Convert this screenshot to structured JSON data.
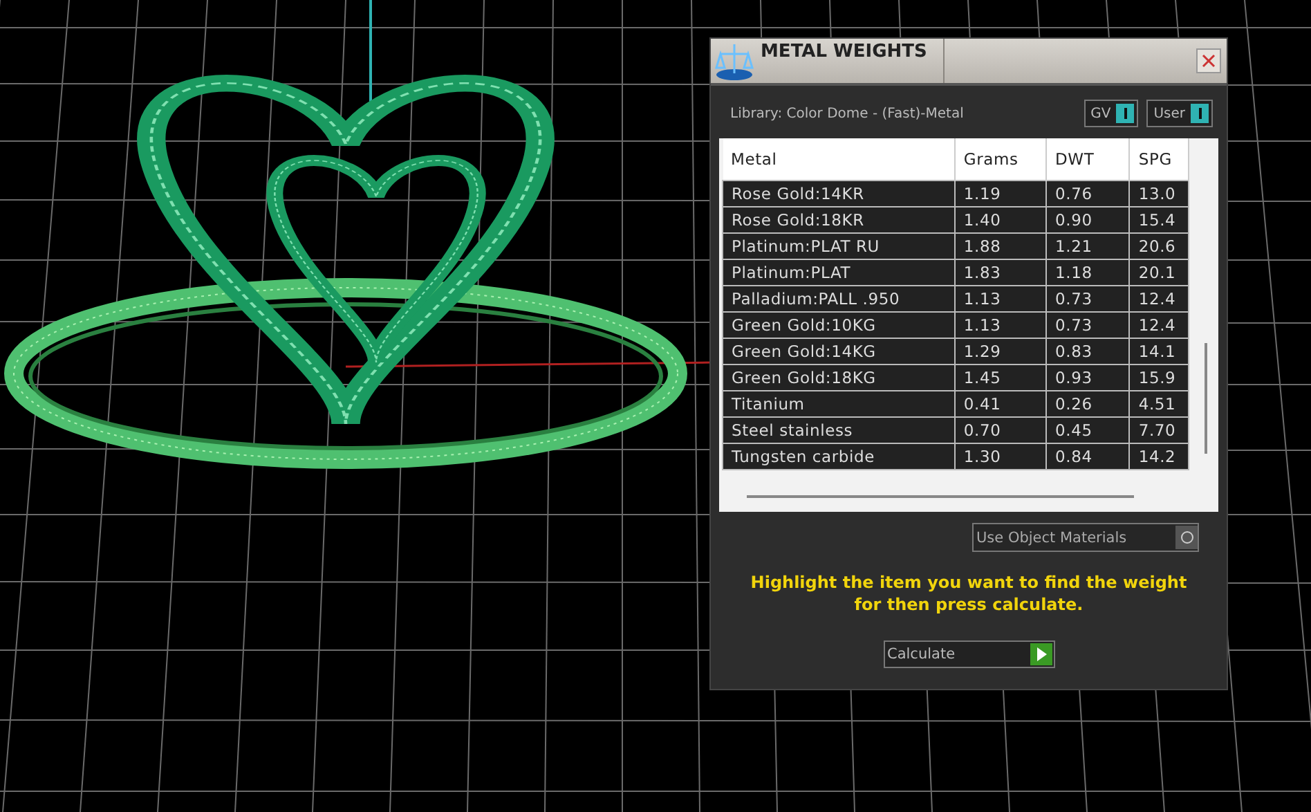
{
  "dialog": {
    "title": "METAL WEIGHTS",
    "library": "Library: Color Dome - (Fast)-Metal",
    "toggles": [
      {
        "label": "GV",
        "on": true
      },
      {
        "label": "User",
        "on": true
      }
    ],
    "table": {
      "columns": [
        "Metal",
        "Grams",
        "DWT",
        "SPG"
      ],
      "rows": [
        [
          "Rose Gold:14KR",
          "1.19",
          "0.76",
          "13.0"
        ],
        [
          "Rose Gold:18KR",
          "1.40",
          "0.90",
          "15.4"
        ],
        [
          "Platinum:PLAT RU",
          "1.88",
          "1.21",
          "20.6"
        ],
        [
          "Platinum:PLAT",
          "1.83",
          "1.18",
          "20.1"
        ],
        [
          "Palladium:PALL .950",
          "1.13",
          "0.73",
          "12.4"
        ],
        [
          "Green Gold:10KG",
          "1.13",
          "0.73",
          "12.4"
        ],
        [
          "Green Gold:14KG",
          "1.29",
          "0.83",
          "14.1"
        ],
        [
          "Green Gold:18KG",
          "1.45",
          "0.93",
          "15.9"
        ],
        [
          "Titanium",
          "0.41",
          "0.26",
          "4.51"
        ],
        [
          "Steel stainless",
          "0.70",
          "0.45",
          "7.70"
        ],
        [
          "Tungsten carbide",
          "1.30",
          "0.84",
          "14.2"
        ]
      ]
    },
    "use_object_materials": {
      "label": "Use Object Materials",
      "on": false
    },
    "hint": "Highlight the item you want to find the weight for then press calculate.",
    "calculate_button": "Calculate"
  }
}
